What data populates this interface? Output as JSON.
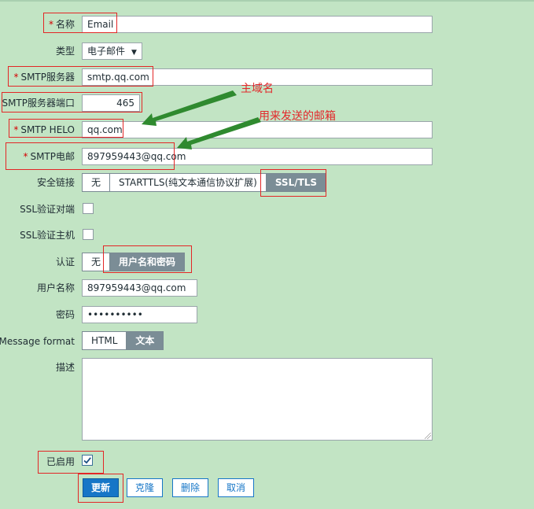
{
  "form": {
    "name": {
      "label": "名称",
      "value": "Email"
    },
    "type": {
      "label": "类型",
      "value": "电子邮件"
    },
    "smtp_server": {
      "label": "SMTP服务器",
      "value": "smtp.qq.com"
    },
    "smtp_port": {
      "label": "SMTP服务器端口",
      "value": "465"
    },
    "smtp_helo": {
      "label": "SMTP HELO",
      "value": "qq.com"
    },
    "smtp_email": {
      "label": "SMTP电邮",
      "value": "897959443@qq.com"
    },
    "security": {
      "label": "安全链接",
      "options": [
        "无",
        "STARTTLS(纯文本通信协议扩展)",
        "SSL/TLS"
      ],
      "selected": "SSL/TLS"
    },
    "ssl_verify_peer": {
      "label": "SSL验证对端",
      "checked": false
    },
    "ssl_verify_host": {
      "label": "SSL验证主机",
      "checked": false
    },
    "auth": {
      "label": "认证",
      "options": [
        "无",
        "用户名和密码"
      ],
      "selected": "用户名和密码"
    },
    "username": {
      "label": "用户名称",
      "value": "897959443@qq.com"
    },
    "password": {
      "label": "密码",
      "value": "••••••••••"
    },
    "message_format": {
      "label": "Message format",
      "options": [
        "HTML",
        "文本"
      ],
      "selected": "文本"
    },
    "description": {
      "label": "描述",
      "value": ""
    },
    "enabled": {
      "label": "已启用",
      "checked": true
    }
  },
  "buttons": {
    "update": "更新",
    "clone": "克隆",
    "delete": "删除",
    "cancel": "取消"
  },
  "annotations": {
    "main_domain": "主域名",
    "sender_mailbox": "用来发送的邮箱"
  },
  "colors": {
    "background": "#c2e4c4",
    "primary": "#1676c7",
    "annotation": "#e3282b",
    "arrow": "#2f8a2f",
    "active_segment": "#7b8d96"
  },
  "icons": {
    "required": "asterisk",
    "checked": "checkmark-icon",
    "arrow": "green-arrow"
  }
}
